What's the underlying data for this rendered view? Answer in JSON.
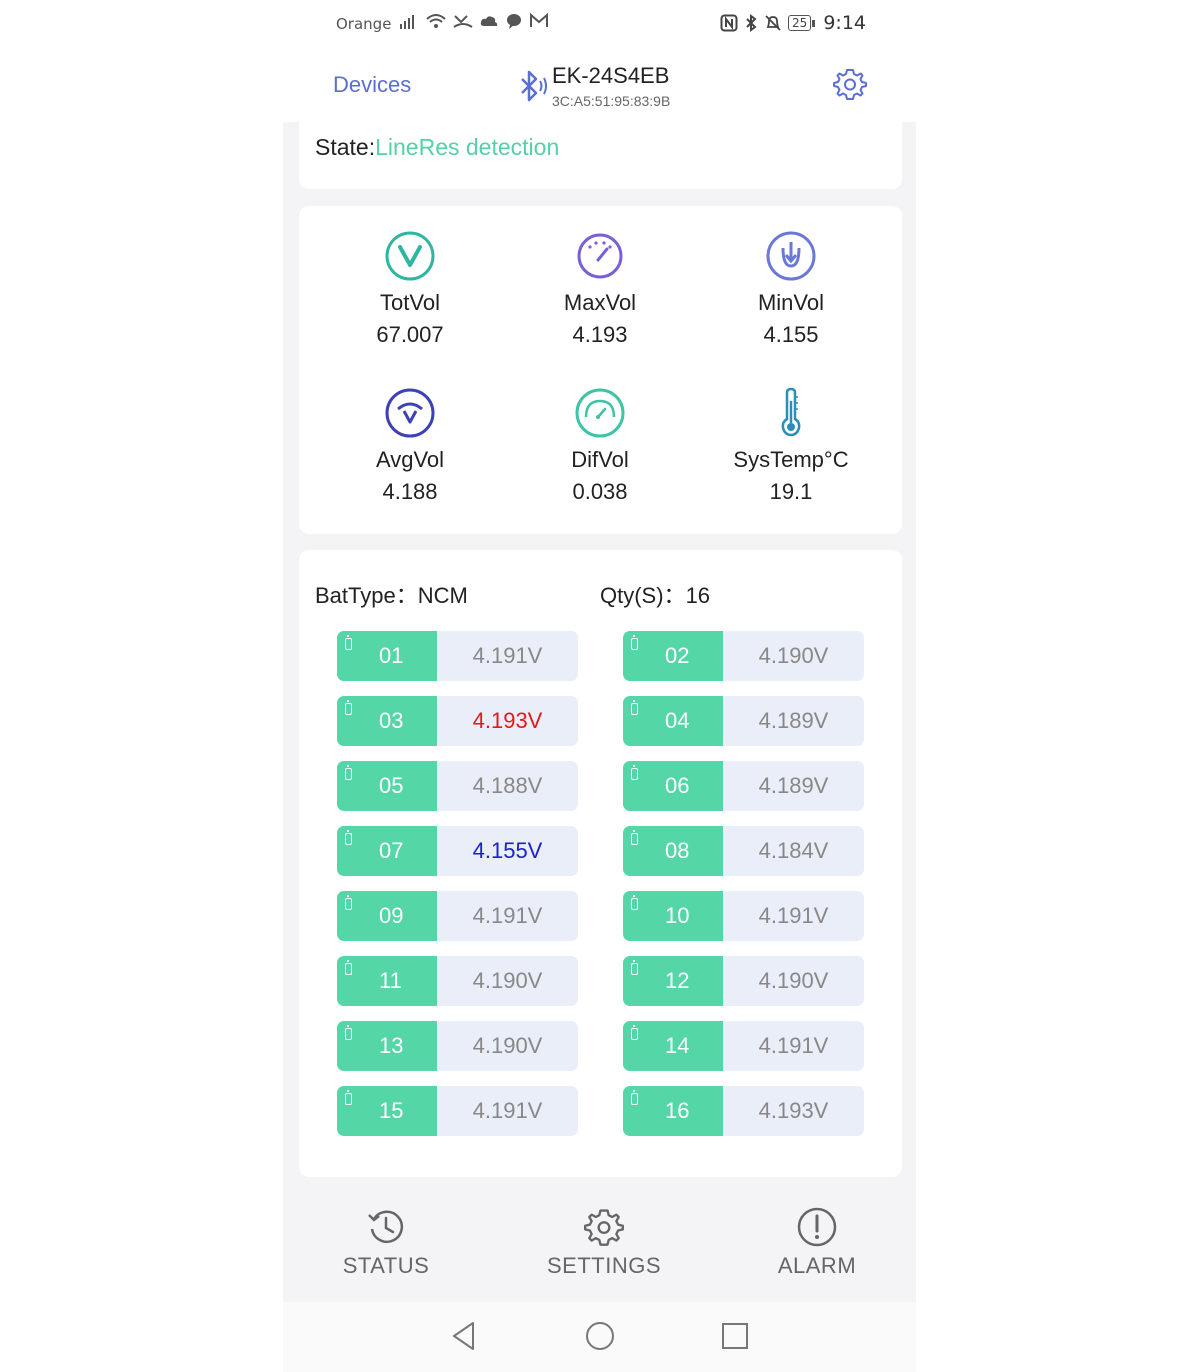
{
  "status_bar": {
    "carrier": "Orange",
    "battery": "25",
    "time": "9:14"
  },
  "header": {
    "back_label": "Devices",
    "device_name": "EK-24S4EB",
    "device_mac": "3C:A5:51:95:83:9B"
  },
  "state": {
    "label": "State:",
    "value": "LineRes detection"
  },
  "stats": [
    {
      "label": "TotVol",
      "value": "67.007",
      "icon": "check-circle-icon",
      "color": "#2fb5a0"
    },
    {
      "label": "MaxVol",
      "value": "4.193",
      "icon": "gauge-icon",
      "color": "#7a5fd6"
    },
    {
      "label": "MinVol",
      "value": "4.155",
      "icon": "arrow-down-circle-icon",
      "color": "#6a78d8"
    },
    {
      "label": "AvgVol",
      "value": "4.188",
      "icon": "wave-v-icon",
      "color": "#3d40b8"
    },
    {
      "label": "DifVol",
      "value": "0.038",
      "icon": "speedometer-icon",
      "color": "#3cc4a4"
    },
    {
      "label": "SysTemp°C",
      "value": "19.1",
      "icon": "thermometer-icon",
      "color": "#2a8fb8"
    }
  ],
  "battery_info": {
    "type_label": "BatType：",
    "type_value": "NCM",
    "qty_label": "Qty(S)：",
    "qty_value": "16"
  },
  "cells": [
    {
      "num": "01",
      "volt": "4.191V",
      "flag": ""
    },
    {
      "num": "02",
      "volt": "4.190V",
      "flag": ""
    },
    {
      "num": "03",
      "volt": "4.193V",
      "flag": "max"
    },
    {
      "num": "04",
      "volt": "4.189V",
      "flag": ""
    },
    {
      "num": "05",
      "volt": "4.188V",
      "flag": ""
    },
    {
      "num": "06",
      "volt": "4.189V",
      "flag": ""
    },
    {
      "num": "07",
      "volt": "4.155V",
      "flag": "min"
    },
    {
      "num": "08",
      "volt": "4.184V",
      "flag": ""
    },
    {
      "num": "09",
      "volt": "4.191V",
      "flag": ""
    },
    {
      "num": "10",
      "volt": "4.191V",
      "flag": ""
    },
    {
      "num": "11",
      "volt": "4.190V",
      "flag": ""
    },
    {
      "num": "12",
      "volt": "4.190V",
      "flag": ""
    },
    {
      "num": "13",
      "volt": "4.190V",
      "flag": ""
    },
    {
      "num": "14",
      "volt": "4.191V",
      "flag": ""
    },
    {
      "num": "15",
      "volt": "4.191V",
      "flag": ""
    },
    {
      "num": "16",
      "volt": "4.193V",
      "flag": ""
    }
  ],
  "tabs": [
    {
      "label": "STATUS",
      "icon": "history-icon"
    },
    {
      "label": "SETTINGS",
      "icon": "settings-icon"
    },
    {
      "label": "ALARM",
      "icon": "alert-icon"
    }
  ],
  "colors": {
    "accent": "#5a6fd0",
    "cell_green": "#55d6a7",
    "max_red": "#e01b1b",
    "min_blue": "#1b22c8"
  }
}
